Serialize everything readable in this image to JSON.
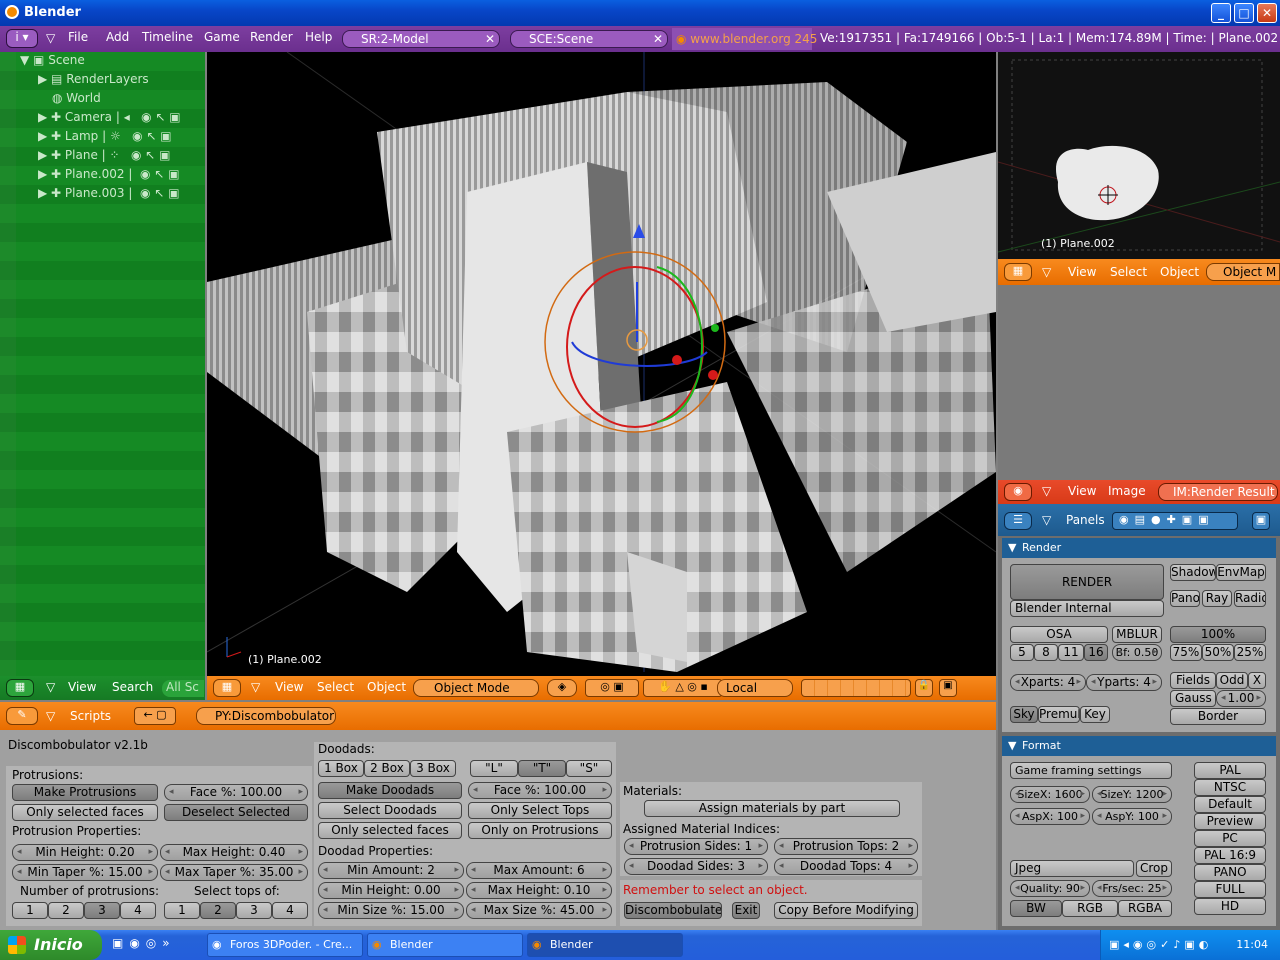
{
  "window": {
    "title": "Blender",
    "min": "_",
    "max": "□",
    "close": "✕"
  },
  "topbar": {
    "menus": [
      "File",
      "Add",
      "Timeline",
      "Game",
      "Render",
      "Help"
    ],
    "screen_field": "SR:2-Model",
    "scene_field": "SCE:Scene",
    "url": "www.blender.org 245",
    "stats": "Ve:1917351 | Fa:1749166 | Ob:5-1 | La:1  | Mem:174.89M  | Time:  | Plane.002"
  },
  "outliner": {
    "items": [
      "Scene",
      "RenderLayers",
      "World",
      "Camera",
      "Lamp",
      "Plane",
      "Plane.002",
      "Plane.003"
    ],
    "footer_menus": [
      "View",
      "Search"
    ],
    "footer_field": "All Sc"
  },
  "view3d": {
    "object_label": "(1) Plane.002",
    "header_menus": [
      "View",
      "Select",
      "Object"
    ],
    "mode": "Object Mode",
    "orientation": "Local"
  },
  "preview": {
    "object_label": "(1) Plane.002",
    "menus": [
      "View",
      "Select",
      "Object"
    ],
    "mode": "Object M"
  },
  "imagewin": {
    "menus": [
      "View",
      "Image"
    ],
    "field": "IM:Render Result"
  },
  "buttons": {
    "header": "Panels",
    "render": {
      "title": "Render",
      "render_btn": "RENDER",
      "renderer": "Blender Internal",
      "shadow": "Shadow",
      "envmap": "EnvMap",
      "pano": "Pano",
      "ray": "Ray",
      "radio": "Radio",
      "osa": "OSA",
      "osa_vals": [
        "5",
        "8",
        "11",
        "16"
      ],
      "mblur": "MBLUR",
      "bf": "Bf: 0.50",
      "pct": [
        "100%",
        "75%",
        "50%",
        "25%"
      ],
      "xparts": "Xparts: 4",
      "yparts": "Yparts: 4",
      "fields": "Fields",
      "odd": "Odd",
      "x": "X",
      "gauss": "Gauss",
      "gauss_val": "1.00",
      "sky": "Sky",
      "premul": "Premul",
      "key": "Key",
      "border": "Border"
    },
    "format": {
      "title": "Format",
      "preset": "Game framing settings",
      "sizex": "SizeX: 1600",
      "sizey": "SizeY: 1200",
      "aspx": "AspX: 100",
      "aspy": "AspY: 100",
      "presets": [
        "PAL",
        "NTSC",
        "Default",
        "Preview",
        "PC",
        "PAL 16:9",
        "PANO",
        "FULL",
        "HD"
      ],
      "filetype": "Jpeg",
      "crop": "Crop",
      "quality": "Quality: 90",
      "fps": "Frs/sec: 25",
      "bw": "BW",
      "rgb": "RGB",
      "rgba": "RGBA"
    }
  },
  "scripts": {
    "header_menu": "Scripts",
    "script_field": "PY:Discombobulator",
    "title": "Discombobulator v2.1b",
    "protrusions": "Protrusions:",
    "make_protrusions": "Make Protrusions",
    "face_pct": "Face %: 100.00",
    "only_selected": "Only selected faces",
    "deselect_selected": "Deselect Selected",
    "prot_props": "Protrusion Properties:",
    "min_height": "Min Height: 0.20",
    "max_height": "Max Height: 0.40",
    "min_taper": "Min Taper %: 15.00",
    "max_taper": "Max Taper %: 35.00",
    "num_prot": "Number of protrusions:",
    "select_tops": "Select tops of:",
    "nums": [
      "1",
      "2",
      "3",
      "4"
    ],
    "doodads": "Doodads:",
    "box": [
      "1 Box",
      "2 Box",
      "3 Box"
    ],
    "shapes": [
      "\"L\"",
      "\"T\"",
      "\"S\""
    ],
    "make_doodads": "Make Doodads",
    "d_face_pct": "Face %: 100.00",
    "select_doodads": "Select Doodads",
    "only_select_tops": "Only Select Tops",
    "d_only_selected": "Only selected faces",
    "only_on_prot": "Only on Protrusions",
    "doodad_props": "Doodad Properties:",
    "min_amount": "Min Amount: 2",
    "max_amount": "Max Amount: 6",
    "d_min_height": "Min Height: 0.00",
    "d_max_height": "Max Height: 0.10",
    "min_size": "Min Size %: 15.00",
    "max_size": "Max Size %: 45.00",
    "materials": "Materials:",
    "assign_mat": "Assign materials by part",
    "assigned": "Assigned Material Indices:",
    "prot_sides": "Protrusion Sides: 1",
    "prot_tops": "Protrusion Tops: 2",
    "doodad_sides": "Doodad Sides: 3",
    "doodad_tops": "Doodad Tops: 4",
    "warning": "Remember to select an object.",
    "discombobulate": "Discombobulate",
    "exit": "Exit",
    "copy_before": "Copy Before Modifying"
  },
  "taskbar": {
    "start": "Inicio",
    "tasks": [
      "Foros 3DPoder. - Cre...",
      "Blender",
      "Blender"
    ],
    "clock": "11:04"
  }
}
